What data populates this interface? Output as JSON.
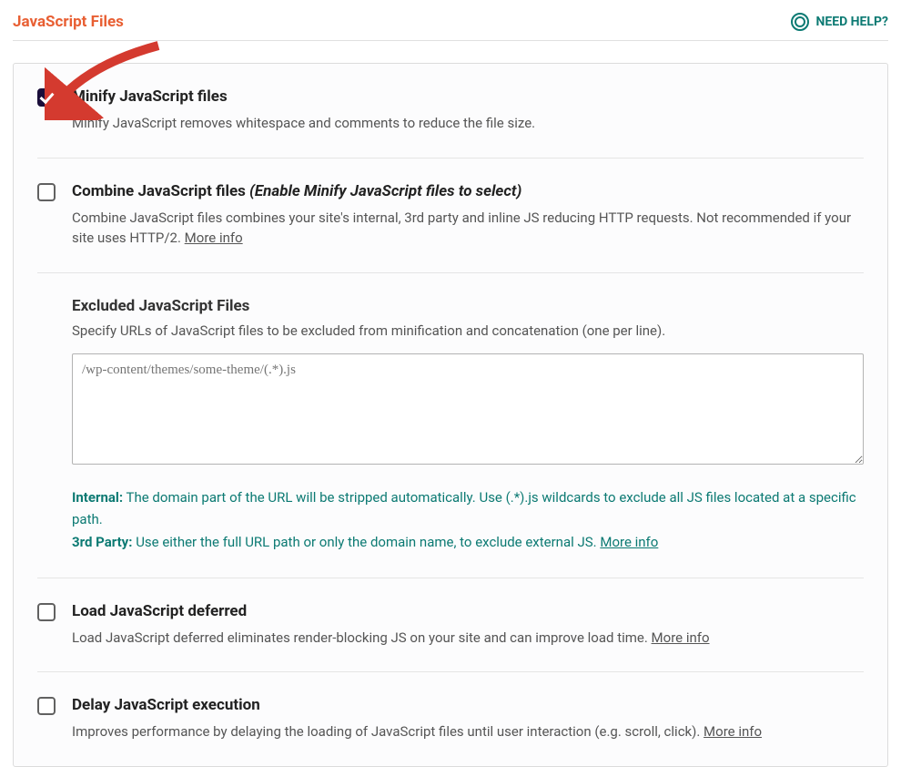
{
  "header": {
    "title": "JavaScript Files",
    "help_label": "NEED HELP?"
  },
  "options": {
    "minify": {
      "title": "Minify JavaScript files",
      "desc": "Minify JavaScript removes whitespace and comments to reduce the file size.",
      "checked": true
    },
    "combine": {
      "title": "Combine JavaScript files",
      "subtitle": "(Enable Minify JavaScript files to select)",
      "desc": "Combine JavaScript files combines your site's internal, 3rd party and inline JS reducing HTTP requests. Not recommended if your site uses HTTP/2. ",
      "more_info": "More info",
      "checked": false
    },
    "excluded": {
      "title": "Excluded JavaScript Files",
      "desc": "Specify URLs of JavaScript files to be excluded from minification and concatenation (one per line).",
      "placeholder": "/wp-content/themes/some-theme/(.*).js",
      "value": "",
      "hint_internal_label": "Internal:",
      "hint_internal": " The domain part of the URL will be stripped automatically. Use (.*).js wildcards to exclude all JS files located at a specific path.",
      "hint_third_label": "3rd Party:",
      "hint_third": " Use either the full URL path or only the domain name, to exclude external JS. ",
      "more_info": "More info"
    },
    "defer": {
      "title": "Load JavaScript deferred",
      "desc": "Load JavaScript deferred eliminates render-blocking JS on your site and can improve load time. ",
      "more_info": "More info",
      "checked": false
    },
    "delay": {
      "title": "Delay JavaScript execution",
      "desc": "Improves performance by delaying the loading of JavaScript files until user interaction (e.g. scroll, click). ",
      "more_info": "More info",
      "checked": false
    }
  }
}
